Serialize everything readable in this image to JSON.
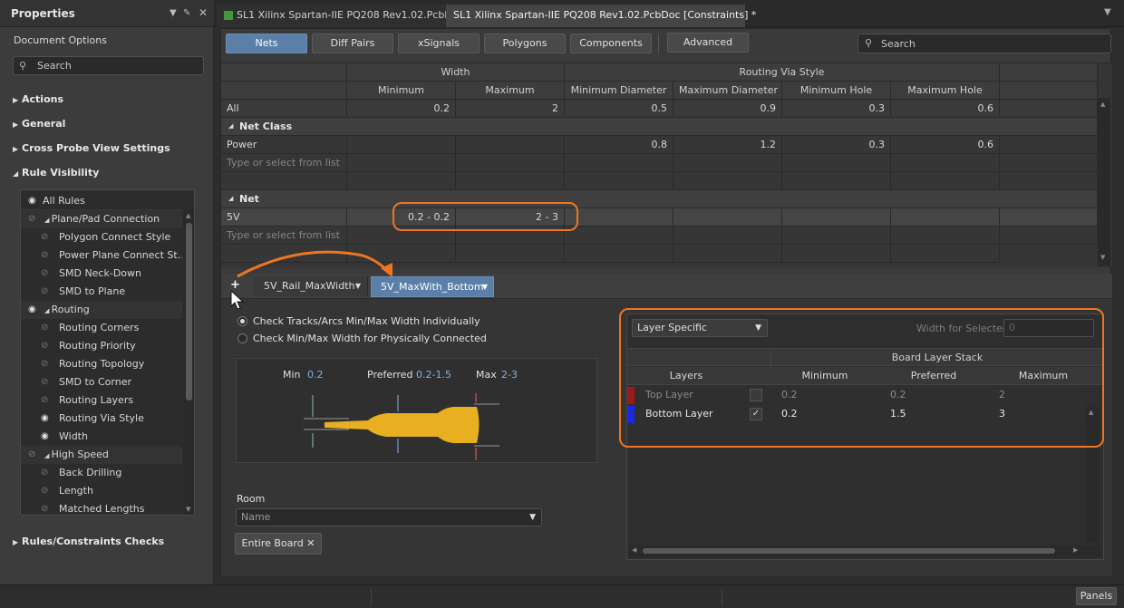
{
  "left_panel": {
    "title": "Properties",
    "subtitle": "Document Options",
    "search_placeholder": "Search",
    "sections": [
      "Actions",
      "General",
      "Cross Probe View Settings",
      "Rule Visibility",
      "Rules/Constraints Checks"
    ],
    "rule_items": [
      {
        "label": "All Rules",
        "eye": "shown",
        "indent": 0
      },
      {
        "label": "Plane/Pad Connection",
        "eye": "hidden",
        "indent": 1,
        "group": true
      },
      {
        "label": "Polygon Connect Style",
        "eye": "hidden",
        "indent": 2
      },
      {
        "label": "Power Plane Connect St...",
        "eye": "hidden",
        "indent": 2
      },
      {
        "label": "SMD Neck-Down",
        "eye": "hidden",
        "indent": 2
      },
      {
        "label": "SMD to Plane",
        "eye": "hidden",
        "indent": 2
      },
      {
        "label": "Routing",
        "eye": "shown",
        "indent": 1,
        "group": true
      },
      {
        "label": "Routing Corners",
        "eye": "hidden",
        "indent": 2
      },
      {
        "label": "Routing Priority",
        "eye": "hidden",
        "indent": 2
      },
      {
        "label": "Routing Topology",
        "eye": "hidden",
        "indent": 2
      },
      {
        "label": "SMD to Corner",
        "eye": "hidden",
        "indent": 2
      },
      {
        "label": "Routing Layers",
        "eye": "hidden",
        "indent": 2
      },
      {
        "label": "Routing Via Style",
        "eye": "shown",
        "indent": 2
      },
      {
        "label": "Width",
        "eye": "shown",
        "indent": 2
      },
      {
        "label": "High Speed",
        "eye": "hidden",
        "indent": 1,
        "group": true
      },
      {
        "label": "Back Drilling",
        "eye": "hidden",
        "indent": 2
      },
      {
        "label": "Length",
        "eye": "hidden",
        "indent": 2
      },
      {
        "label": "Matched Lengths",
        "eye": "hidden",
        "indent": 2
      }
    ]
  },
  "tabs": [
    "SL1 Xilinx Spartan-IIE PQ208 Rev1.02.PcbDoc",
    "SL1 Xilinx Spartan-IIE PQ208 Rev1.02.PcbDoc [Constraints] *"
  ],
  "toolbar": {
    "buttons": [
      "Nets",
      "Diff Pairs",
      "xSignals",
      "Polygons",
      "Components",
      "Advanced"
    ],
    "active": "Nets",
    "search_placeholder": "Search"
  },
  "grid": {
    "group_headers": [
      "Width",
      "Routing Via Style"
    ],
    "columns": [
      "Minimum",
      "Maximum",
      "Minimum Diameter",
      "Maximum Diameter",
      "Minimum Hole",
      "Maximum Hole"
    ],
    "all_row": {
      "label": "All",
      "values": [
        "0.2",
        "2",
        "0.5",
        "0.9",
        "0.3",
        "0.6"
      ]
    },
    "net_class_label": "Net Class",
    "power_row": {
      "label": "Power",
      "values": [
        "",
        "",
        "0.8",
        "1.2",
        "0.3",
        "0.6"
      ]
    },
    "placeholder": "Type or select from list",
    "net_label": "Net",
    "net_row": {
      "label": "5V",
      "values": [
        "0.2 - 0.2",
        "2 - 3",
        "",
        "",
        "",
        ""
      ]
    }
  },
  "rule_tabs": {
    "add": "+",
    "items": [
      "5V_Rail_MaxWidth",
      "5V_MaxWith_Bottom"
    ],
    "active": "5V_MaxWith_Bottom"
  },
  "options": {
    "radio1": "Check Tracks/Arcs Min/Max Width Individually",
    "radio2": "Check Min/Max Width for Physically Connected"
  },
  "diagram": {
    "min_label": "Min",
    "min_value": "0.2",
    "pref_label": "Preferred",
    "pref_value": "0.2-1.5",
    "max_label": "Max",
    "max_value": "2-3"
  },
  "room": {
    "label": "Room",
    "placeholder": "Name",
    "chip": "Entire Board"
  },
  "layers": {
    "mode": "Layer Specific",
    "width_for_selected_label": "Width for Selected",
    "width_for_selected_value": "0",
    "stack_header": "Board Layer Stack",
    "columns": [
      "Layers",
      "Minimum",
      "Preferred",
      "Maximum"
    ],
    "rows": [
      {
        "name": "Top Layer",
        "color": "#a01818",
        "checked": false,
        "min": "0.2",
        "pref": "0.2",
        "max": "2"
      },
      {
        "name": "Bottom Layer",
        "color": "#1a28e0",
        "checked": true,
        "min": "0.2",
        "pref": "1.5",
        "max": "3"
      }
    ]
  },
  "status": {
    "panels_button": "Panels"
  },
  "colors": {
    "accent": "#ee7622",
    "active_button": "#5b7fa6",
    "trace": "#e8b020"
  }
}
